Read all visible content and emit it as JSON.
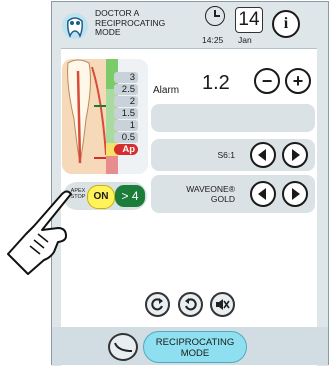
{
  "header": {
    "title_lines": [
      "DOCTOR A",
      "RECIPROCATING",
      "MODE"
    ],
    "time": "14:25",
    "date_day": "14",
    "date_month": "Jan",
    "info_label": "i"
  },
  "apex_scale": [
    "3",
    "2.5",
    "2",
    "1.5",
    "1",
    "0.5",
    "Ap"
  ],
  "alarm": {
    "label": "Alarm",
    "value": "1.2",
    "minus": "−",
    "plus": "+"
  },
  "ratio": {
    "label": "S6:1"
  },
  "file": {
    "label_lines": [
      "WAVEONE®",
      "GOLD"
    ]
  },
  "apex_stop": {
    "icon_lines": [
      "APEX",
      "STOP"
    ],
    "toggle": "ON",
    "value": "> 4"
  },
  "mode": {
    "label_lines": [
      "RECIPROCATING",
      "MODE"
    ]
  },
  "icons": [
    "logo-icon",
    "clock-icon",
    "calendar-icon",
    "info-icon",
    "prev-arrow-icon",
    "next-arrow-icon",
    "rotate-icon",
    "reverse-icon",
    "mute-icon",
    "handpiece-icon",
    "pointing-hand-icon"
  ],
  "colors": {
    "apex_red": "#d52e2e",
    "green": "#1c7d3a",
    "toggle_yellow": "#fff25a",
    "mode_cyan": "#8ee0f0"
  }
}
